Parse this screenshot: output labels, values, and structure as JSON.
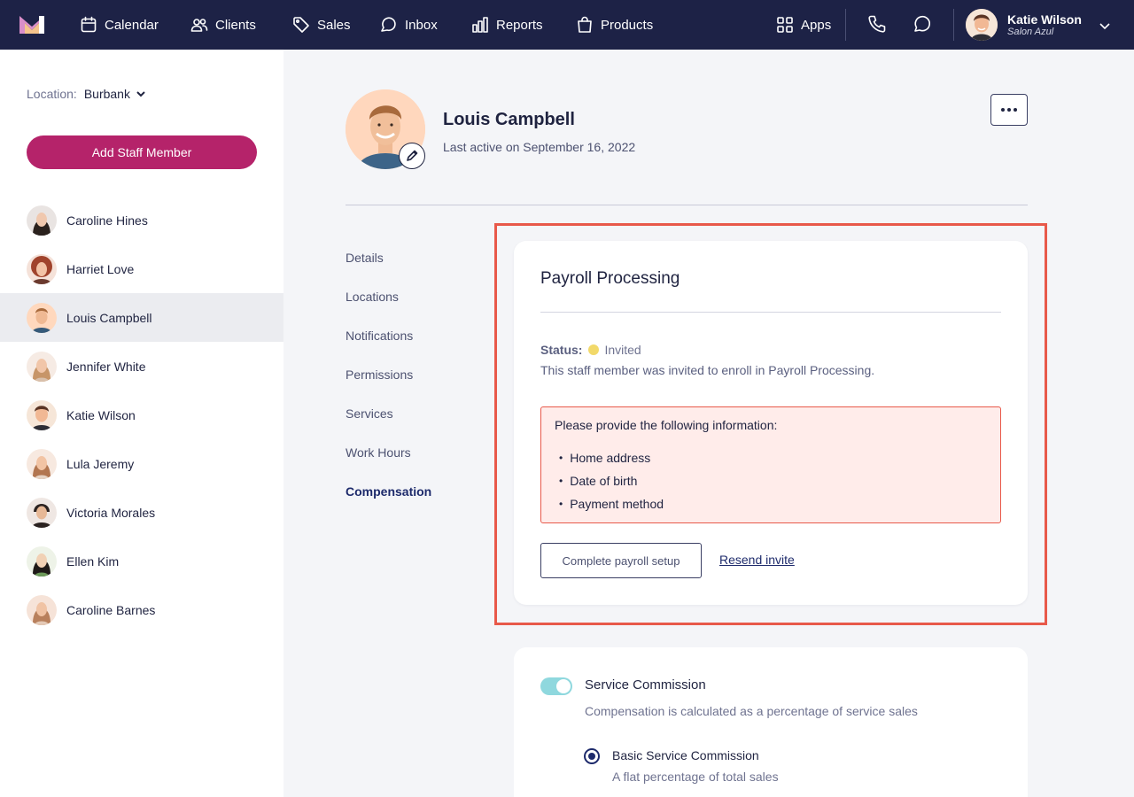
{
  "nav": {
    "items": [
      {
        "label": "Calendar",
        "icon": "calendar-icon"
      },
      {
        "label": "Clients",
        "icon": "clients-icon"
      },
      {
        "label": "Sales",
        "icon": "tag-icon"
      },
      {
        "label": "Inbox",
        "icon": "inbox-icon"
      },
      {
        "label": "Reports",
        "icon": "bar-chart-icon"
      },
      {
        "label": "Products",
        "icon": "shopping-bag-icon"
      }
    ],
    "apps_label": "Apps",
    "user": {
      "name": "Katie Wilson",
      "salon": "Salon Azul"
    }
  },
  "sidebar": {
    "location_label": "Location:",
    "location_value": "Burbank",
    "add_button": "Add Staff Member",
    "staff": [
      {
        "name": "Caroline Hines",
        "active": false
      },
      {
        "name": "Harriet Love",
        "active": false
      },
      {
        "name": "Louis Campbell",
        "active": true
      },
      {
        "name": "Jennifer White",
        "active": false
      },
      {
        "name": "Katie Wilson",
        "active": false
      },
      {
        "name": "Lula Jeremy",
        "active": false
      },
      {
        "name": "Victoria Morales",
        "active": false
      },
      {
        "name": "Ellen Kim",
        "active": false
      },
      {
        "name": "Caroline Barnes",
        "active": false
      }
    ]
  },
  "profile": {
    "name": "Louis Campbell",
    "last_active": "Last active on September 16, 2022"
  },
  "subnav": {
    "items": [
      "Details",
      "Locations",
      "Notifications",
      "Permissions",
      "Services",
      "Work Hours",
      "Compensation"
    ],
    "active": "Compensation"
  },
  "payroll": {
    "title": "Payroll Processing",
    "status_label": "Status:",
    "status_value": "Invited",
    "status_color": "#f2d96a",
    "description": "This staff member was invited to enroll in Payroll Processing.",
    "alert_title": "Please provide the following information:",
    "alert_items": [
      "Home address",
      "Date of birth",
      "Payment method"
    ],
    "complete_button": "Complete payroll setup",
    "resend_link": "Resend invite"
  },
  "commission": {
    "title": "Service Commission",
    "description": "Compensation is calculated as a percentage of service sales",
    "option_label": "Basic Service Commission",
    "option_desc": "A flat percentage of total sales"
  },
  "colors": {
    "nav_bg": "#1d2246",
    "accent": "#b5236a",
    "highlight": "#e8594a"
  }
}
